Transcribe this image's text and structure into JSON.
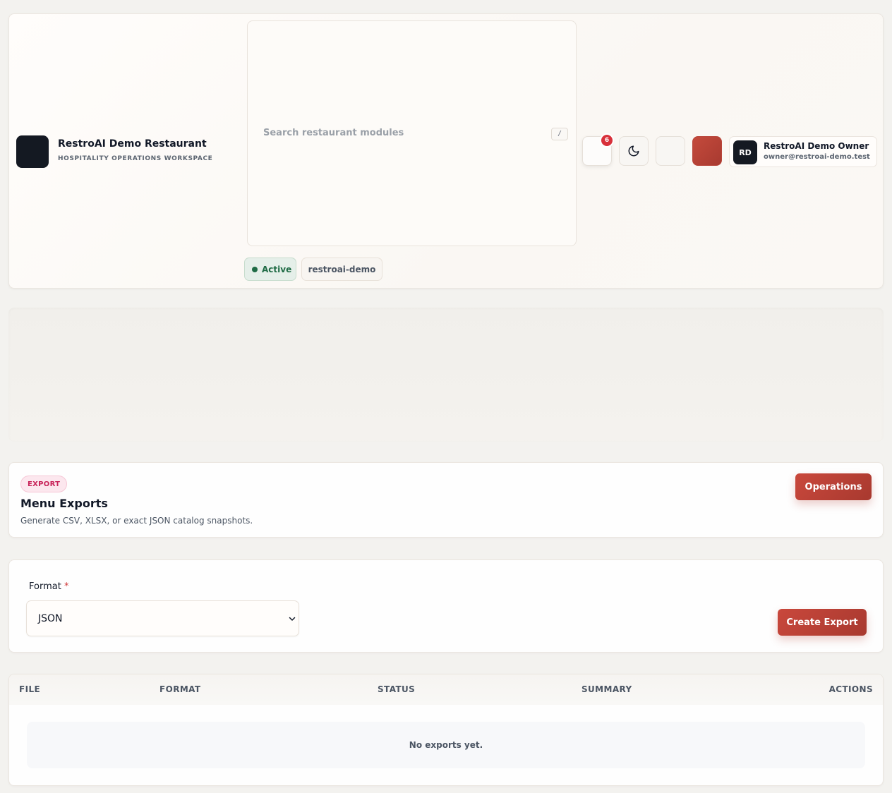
{
  "header": {
    "brand": {
      "title": "RestroAI Demo Restaurant",
      "subtitle": "HOSPITALITY OPERATIONS WORKSPACE"
    },
    "search": {
      "placeholder": "Search restaurant modules",
      "shortcut": "/"
    },
    "status_pill": "Active",
    "tenant_slug": "restroai-demo",
    "notifications": {
      "count": "6",
      "icon": "bell-icon"
    },
    "theme_toggle_icon": "moon-icon",
    "user": {
      "initials": "RD",
      "name": "RestroAI Demo Owner",
      "email": "owner@restroai-demo.test"
    },
    "accent_color": "#c44a3c"
  },
  "export_section": {
    "tag": "EXPORT",
    "title": "Menu Exports",
    "description": "Generate CSV, XLSX, or exact JSON catalog snapshots.",
    "operations_button": "Operations"
  },
  "form": {
    "format_label": "Format",
    "required_mark": "*",
    "format_value": "JSON",
    "create_button": "Create Export"
  },
  "table": {
    "columns": [
      "FILE",
      "FORMAT",
      "STATUS",
      "SUMMARY",
      "ACTIONS"
    ],
    "empty_message": "No exports yet."
  }
}
